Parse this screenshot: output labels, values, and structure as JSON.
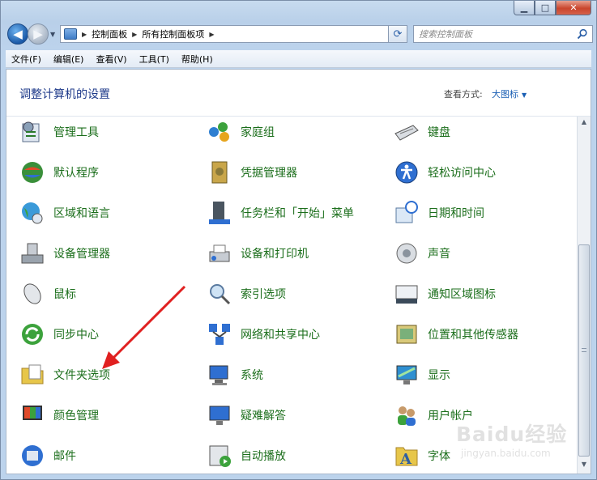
{
  "address": {
    "crumbs": [
      "控制面板",
      "所有控制面板项"
    ]
  },
  "search": {
    "placeholder": "搜索控制面板"
  },
  "menu": [
    "文件(F)",
    "编辑(E)",
    "查看(V)",
    "工具(T)",
    "帮助(H)"
  ],
  "page": {
    "title": "调整计算机的设置",
    "view_by_label": "查看方式:",
    "view_by_value": "大图标"
  },
  "items": [
    {
      "label": "管理工具",
      "icon": "admin-tools-icon"
    },
    {
      "label": "家庭组",
      "icon": "homegroup-icon"
    },
    {
      "label": "键盘",
      "icon": "keyboard-icon"
    },
    {
      "label": "默认程序",
      "icon": "default-programs-icon"
    },
    {
      "label": "凭据管理器",
      "icon": "credential-manager-icon"
    },
    {
      "label": "轻松访问中心",
      "icon": "ease-of-access-icon"
    },
    {
      "label": "区域和语言",
      "icon": "region-language-icon"
    },
    {
      "label": "任务栏和「开始」菜单",
      "icon": "taskbar-start-icon"
    },
    {
      "label": "日期和时间",
      "icon": "date-time-icon"
    },
    {
      "label": "设备管理器",
      "icon": "device-manager-icon"
    },
    {
      "label": "设备和打印机",
      "icon": "devices-printers-icon"
    },
    {
      "label": "声音",
      "icon": "sound-icon"
    },
    {
      "label": "鼠标",
      "icon": "mouse-icon"
    },
    {
      "label": "索引选项",
      "icon": "indexing-options-icon"
    },
    {
      "label": "通知区域图标",
      "icon": "notification-area-icon"
    },
    {
      "label": "同步中心",
      "icon": "sync-center-icon"
    },
    {
      "label": "网络和共享中心",
      "icon": "network-sharing-icon"
    },
    {
      "label": "位置和其他传感器",
      "icon": "location-sensors-icon"
    },
    {
      "label": "文件夹选项",
      "icon": "folder-options-icon"
    },
    {
      "label": "系统",
      "icon": "system-icon"
    },
    {
      "label": "显示",
      "icon": "display-icon"
    },
    {
      "label": "颜色管理",
      "icon": "color-management-icon"
    },
    {
      "label": "疑难解答",
      "icon": "troubleshooting-icon"
    },
    {
      "label": "用户帐户",
      "icon": "user-accounts-icon"
    },
    {
      "label": "邮件",
      "icon": "mail-icon"
    },
    {
      "label": "自动播放",
      "icon": "autoplay-icon"
    },
    {
      "label": "字体",
      "icon": "fonts-icon"
    }
  ],
  "watermark": {
    "brand": "Baidu经验",
    "url": "jingyan.baidu.com"
  },
  "colors": {
    "link_green": "#1b6e1b",
    "title_blue": "#1e3a8a",
    "annotation_red": "#e02020"
  }
}
